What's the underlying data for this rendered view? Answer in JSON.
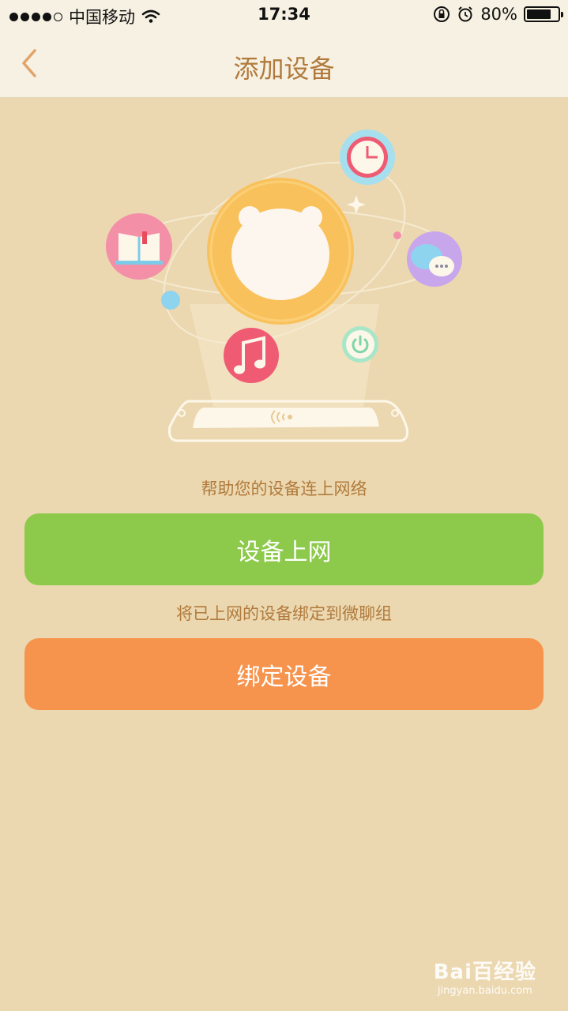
{
  "status_bar": {
    "carrier": "中国移动",
    "time": "17:34",
    "battery": "80%",
    "battery_level": 0.8
  },
  "nav": {
    "title": "添加设备",
    "back_icon": "chevron-left-icon"
  },
  "main": {
    "hint_network": "帮助您的设备连上网络",
    "button_network": "设备上网",
    "hint_bind": "将已上网的设备绑定到微聊组",
    "button_bind": "绑定设备"
  },
  "colors": {
    "background": "#ecd8b0",
    "nav_bg": "#f7f1e3",
    "title_color": "#b07a3c",
    "green_button": "#8dca4b",
    "orange_button": "#f6944e"
  },
  "watermark": {
    "logo": "Bai百经验",
    "url": "jingyan.baidu.com"
  }
}
